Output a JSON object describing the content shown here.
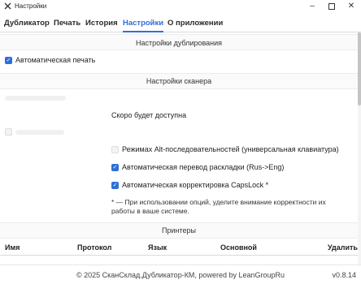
{
  "window": {
    "title": "Настройки",
    "icon": "scanner-app-icon"
  },
  "tabs": [
    {
      "label": "Дубликатор"
    },
    {
      "label": "Печать"
    },
    {
      "label": "История"
    },
    {
      "label": "Настройки",
      "active": true
    },
    {
      "label": "О приложении"
    }
  ],
  "duplication": {
    "header": "Настройки дублирования",
    "auto_print": {
      "label": "Автоматическая печать",
      "checked": true
    }
  },
  "scanner": {
    "header": "Настройки сканера",
    "coming_soon": "Скоро будет доступна",
    "options": [
      {
        "label": "Режимах Alt-последовательностей (универсальная клавиатура)",
        "checked": false
      },
      {
        "label": "Автоматическая перевод раскладки (Rus->Eng)",
        "checked": true
      },
      {
        "label": "Автоматическая корректировка CapsLock *",
        "checked": true
      }
    ],
    "note": "* — При использовании опций, уделите внимание корректности их работы в ваше системе."
  },
  "printers": {
    "header": "Принтеры",
    "columns": [
      "Имя",
      "Протокол",
      "Язык",
      "Основной",
      "Удалить"
    ]
  },
  "footer": {
    "copyright": "© 2025 СканСклад.Дубликатор-КМ, powered by LeanGroupRu",
    "version": "v0.8.14"
  },
  "colors": {
    "accent": "#2e6fd8"
  }
}
